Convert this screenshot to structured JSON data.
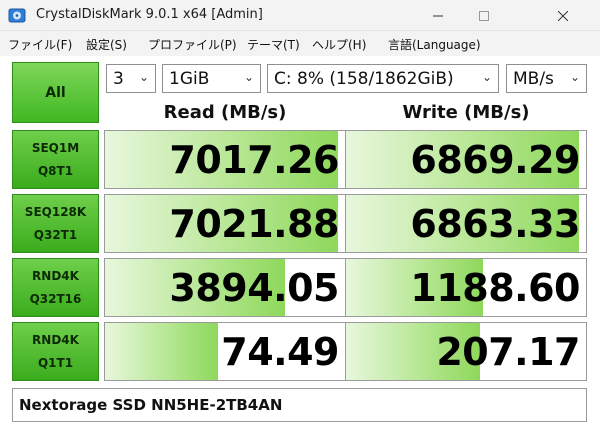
{
  "window": {
    "title": "CrystalDiskMark 9.0.1 x64 [Admin]",
    "app_icon": "crystaldiskmark-disk-icon"
  },
  "menu": [
    "ファイル(F)",
    "設定(S)",
    "プロファイル(P)",
    "テーマ(T)",
    "ヘルプ(H)",
    "言語(Language)"
  ],
  "controls": {
    "all_label": "All",
    "count": "3",
    "size": "1GiB",
    "drive": "C: 8% (158/1862GiB)",
    "unit": "MB/s"
  },
  "headers": {
    "read": "Read (MB/s)",
    "write": "Write (MB/s)"
  },
  "tests": [
    {
      "line1": "SEQ1M",
      "line2": "Q8T1",
      "read": "7017.26",
      "write": "6869.29",
      "read_fill": 0.97,
      "write_fill": 0.97
    },
    {
      "line1": "SEQ128K",
      "line2": "Q32T1",
      "read": "7021.88",
      "write": "6863.33",
      "read_fill": 0.97,
      "write_fill": 0.97
    },
    {
      "line1": "RND4K",
      "line2": "Q32T16",
      "read": "3894.05",
      "write": "1188.60",
      "read_fill": 0.75,
      "write_fill": 0.57
    },
    {
      "line1": "RND4K",
      "line2": "Q1T1",
      "read": "74.49",
      "write": "207.17",
      "read_fill": 0.47,
      "write_fill": 0.56
    }
  ],
  "footer": "Nextorage SSD NN5HE-2TB4AN",
  "colors": {
    "accent": "#40b822",
    "bar_end": "#8ed85c"
  }
}
